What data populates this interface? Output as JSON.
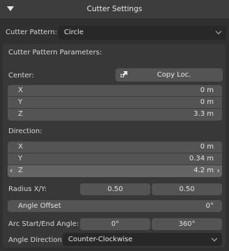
{
  "header": {
    "title": "Cutter Settings"
  },
  "cutter_pattern": {
    "label": "Cutter Pattern:",
    "value": "Circle"
  },
  "params_title": "Cutter Pattern Parameters:",
  "center": {
    "label": "Center:",
    "copy_button": "Copy Loc.",
    "x": {
      "label": "X",
      "value": "0 m"
    },
    "y": {
      "label": "Y",
      "value": "0 m"
    },
    "z": {
      "label": "Z",
      "value": "3.3 m"
    }
  },
  "direction": {
    "label": "Direction:",
    "x": {
      "label": "X",
      "value": "0 m"
    },
    "y": {
      "label": "Y",
      "value": "0.34 m"
    },
    "z": {
      "label": "Z",
      "value": "4.2 m"
    }
  },
  "radius": {
    "label": "Radius X/Y:",
    "x": "0.50",
    "y": "0.50"
  },
  "angle_offset": {
    "label": "Angle Offset",
    "value": "0°"
  },
  "arc": {
    "label": "Arc Start/End Angle:",
    "start": "0°",
    "end": "360°"
  },
  "angle_direction": {
    "label": "Angle Direction:",
    "value": "Counter-Clockwise"
  }
}
